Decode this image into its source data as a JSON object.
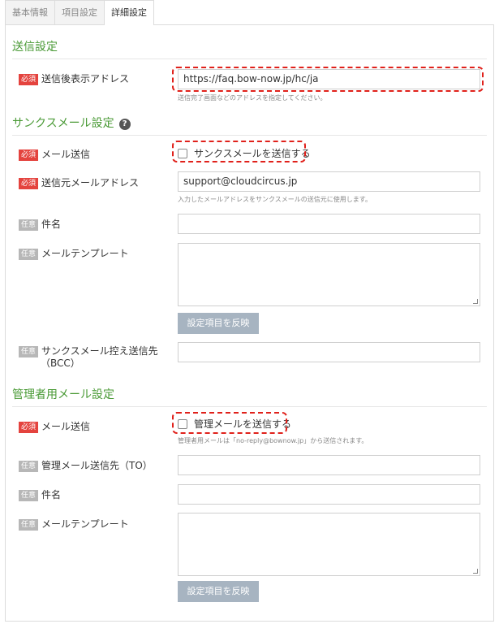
{
  "tabs": [
    {
      "label": "基本情報"
    },
    {
      "label": "項目設定"
    },
    {
      "label": "詳細設定"
    }
  ],
  "sections": {
    "send": {
      "title": "送信設定"
    },
    "thanks": {
      "title": "サンクスメール設定"
    },
    "admin": {
      "title": "管理者用メール設定"
    }
  },
  "badges": {
    "required": "必須",
    "optional": "任意"
  },
  "help_icon": "?",
  "fields": {
    "after_url": {
      "label": "送信後表示アドレス",
      "value": "https://faq.bow-now.jp/hc/ja",
      "hint": "送信完了画面などのアドレスを指定してください。"
    },
    "thanks_send": {
      "label": "メール送信",
      "checkbox_label": "サンクスメールを送信する"
    },
    "thanks_from": {
      "label": "送信元メールアドレス",
      "value": "support@cloudcircus.jp",
      "hint": "入力したメールアドレスをサンクスメールの送信元に使用します。"
    },
    "thanks_subject": {
      "label": "件名",
      "value": ""
    },
    "thanks_template": {
      "label": "メールテンプレート",
      "value": ""
    },
    "thanks_apply": {
      "label": "設定項目を反映"
    },
    "thanks_bcc": {
      "label_line1": "サンクスメール控え送信先",
      "label_line2": "（BCC）",
      "value": ""
    },
    "admin_send": {
      "label": "メール送信",
      "checkbox_label": "管理メールを送信する",
      "hint": "管理者用メールは「no-reply@bownow.jp」から送信されます。"
    },
    "admin_to": {
      "label": "管理メール送信先（TO）",
      "value": ""
    },
    "admin_subject": {
      "label": "件名",
      "value": ""
    },
    "admin_template": {
      "label": "メールテンプレート",
      "value": ""
    },
    "admin_apply": {
      "label": "設定項目を反映"
    }
  },
  "colors": {
    "section_title": "#4a9a36",
    "required_badge": "#e4433e",
    "optional_badge": "#b7b7b7",
    "highlight": "#e0211b",
    "button": "#a7b4c1"
  }
}
